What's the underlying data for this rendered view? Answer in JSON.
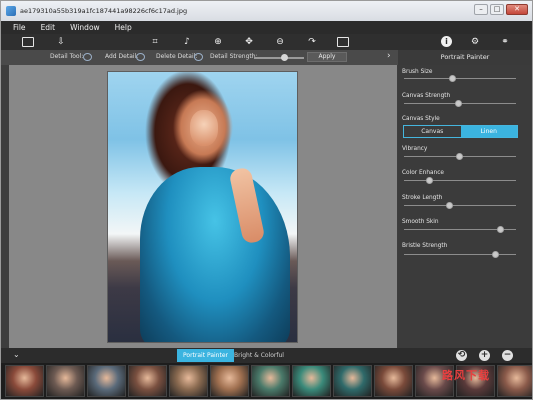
{
  "window": {
    "title": "ae179310a55b319a1fc187441a98226cf6c17ad.jpg",
    "controls": [
      "–",
      "□",
      "✕"
    ]
  },
  "menu": [
    "File",
    "Edit",
    "Window",
    "Help"
  ],
  "options": {
    "detail_tool": "Detail Tool:",
    "add_detail": "Add Detail:",
    "delete_detail": "Delete Detail:",
    "detail_strength": "Detail Strength:",
    "detail_strength_value": 0.58,
    "apply": "Apply"
  },
  "panel": {
    "title": "Portrait Painter",
    "sliders": [
      {
        "label": "Brush Size",
        "value": 0.43
      },
      {
        "label": "Canvas Strength",
        "value": 0.48
      },
      {
        "label": "Vibrancy",
        "value": 0.49
      },
      {
        "label": "Color Enhance",
        "value": 0.22
      },
      {
        "label": "Stroke Length",
        "value": 0.4
      },
      {
        "label": "Smooth Skin",
        "value": 0.86
      },
      {
        "label": "Bristle Strength",
        "value": 0.81
      }
    ],
    "canvas_style_label": "Canvas Style",
    "canvas_style_options": [
      "Canvas",
      "Linen"
    ],
    "canvas_style_selected": "Linen"
  },
  "bottom": {
    "tabs": [
      "Portrait Painter",
      "Bright & Colorful"
    ],
    "active_tab": "Portrait Painter"
  },
  "colors": {
    "accent": "#3bb4e0",
    "thumbs": [
      "#8a4a3a",
      "#6d5a52",
      "#5a6a7a",
      "#7a5040",
      "#8a6a50",
      "#a07050",
      "#4a7a6a",
      "#3a8a7a",
      "#2f6a6a",
      "#7a4a3a",
      "#6a4a4a",
      "#5a3a3a",
      "#8a5a4a"
    ]
  },
  "watermark": "路风下载"
}
